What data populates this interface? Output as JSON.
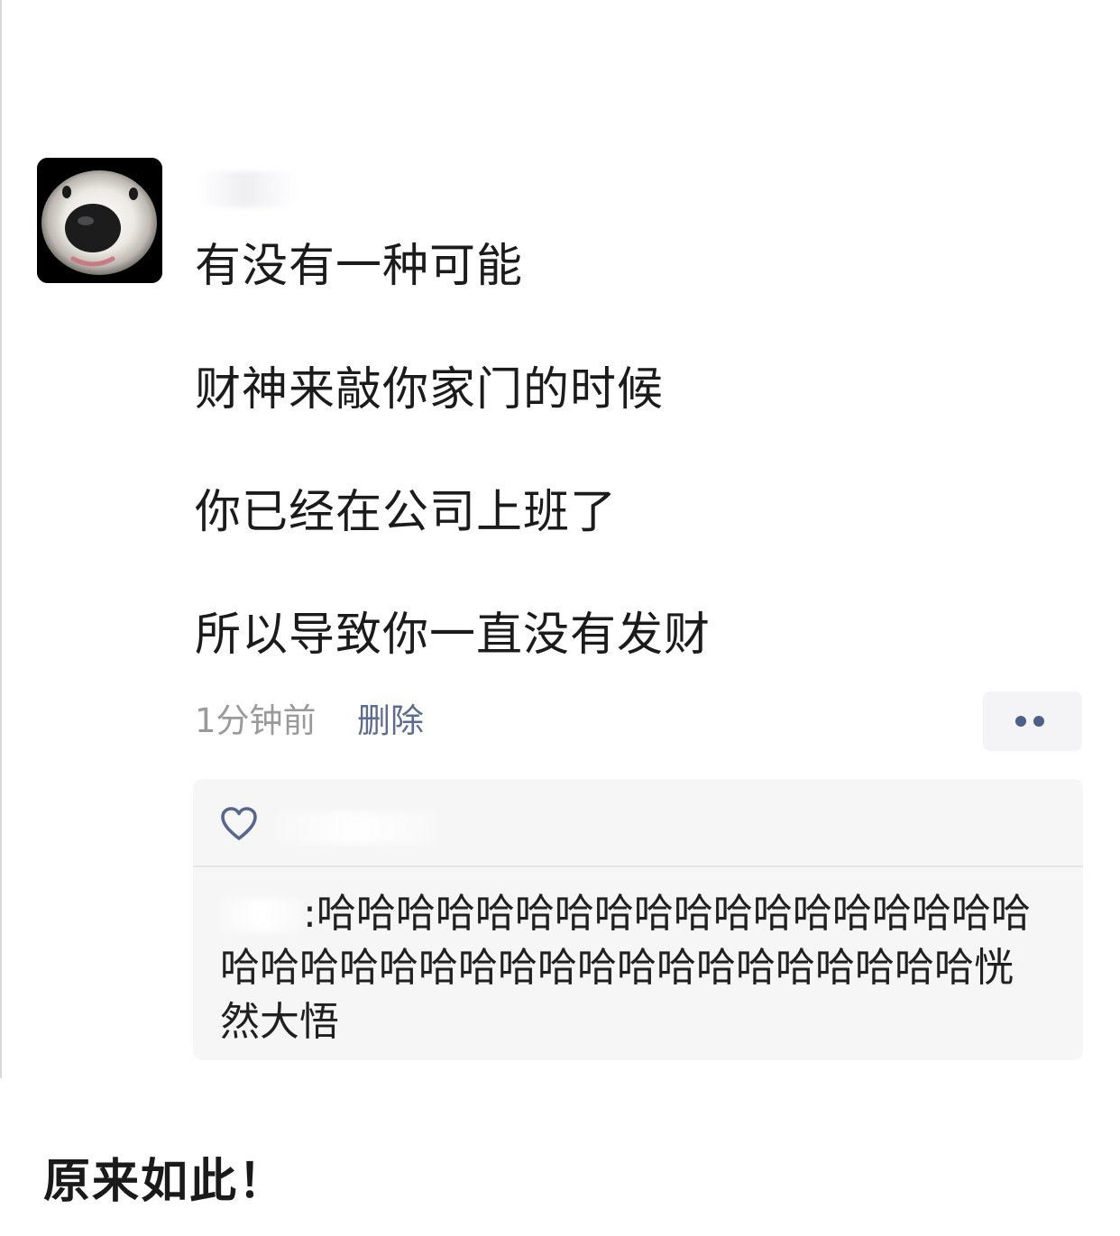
{
  "post": {
    "lines": [
      "有没有一种可能",
      "财神来敲你家门的时候",
      "你已经在公司上班了",
      "所以导致你一直没有发财"
    ],
    "time": "1分钟前",
    "delete_label": "删除"
  },
  "interactions": {
    "comment": {
      "separator": ":",
      "text": "哈哈哈哈哈哈哈哈哈哈哈哈哈哈哈哈哈哈哈哈哈哈哈哈哈哈哈哈哈哈哈哈哈哈哈哈哈恍然大悟"
    }
  },
  "caption": "原来如此！",
  "icons": {
    "avatar": "dog-face-avatar",
    "like": "heart-outline-icon",
    "more": "more-dots-icon"
  },
  "colors": {
    "link": "#5b6b92",
    "meta": "#9a9a9a",
    "panel": "#f6f6f7",
    "dots": "#4e5f88"
  }
}
